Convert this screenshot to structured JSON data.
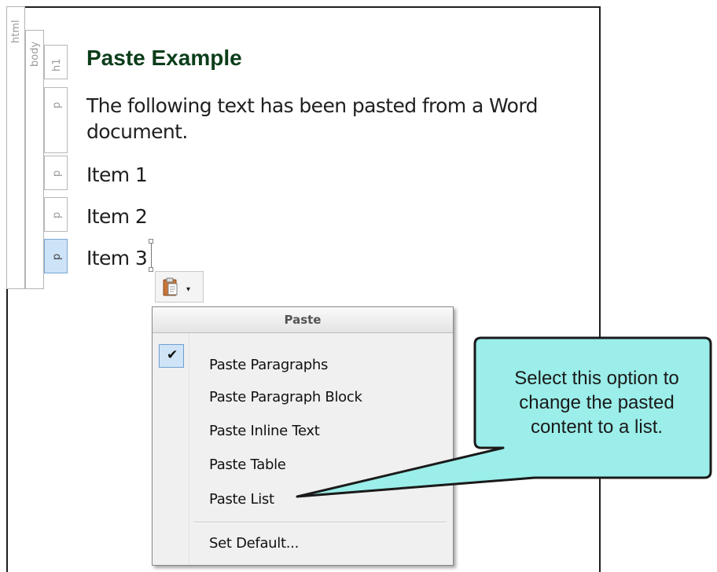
{
  "document": {
    "tags": {
      "html": "html",
      "body": "body",
      "h1": "h1",
      "p": "p"
    },
    "heading": "Paste Example",
    "paragraphs": [
      "The following text has been pasted from a Word",
      "document.",
      "Item 1",
      "Item 2",
      "Item 3"
    ]
  },
  "paste_button": {
    "icon": "clipboard-icon",
    "arrow": "▾"
  },
  "paste_menu": {
    "header": "Paste",
    "items": [
      {
        "label": "Paste Paragraphs",
        "checked": true
      },
      {
        "label": "Paste Paragraph Block"
      },
      {
        "label": "Paste Inline Text"
      },
      {
        "label": "Paste Table"
      },
      {
        "label": "Paste List"
      },
      {
        "label": "Set Default..."
      }
    ]
  },
  "callout": {
    "lines": [
      "Select this option to",
      "change the pasted",
      "content to a list."
    ],
    "fill_color": "#9beee9"
  }
}
